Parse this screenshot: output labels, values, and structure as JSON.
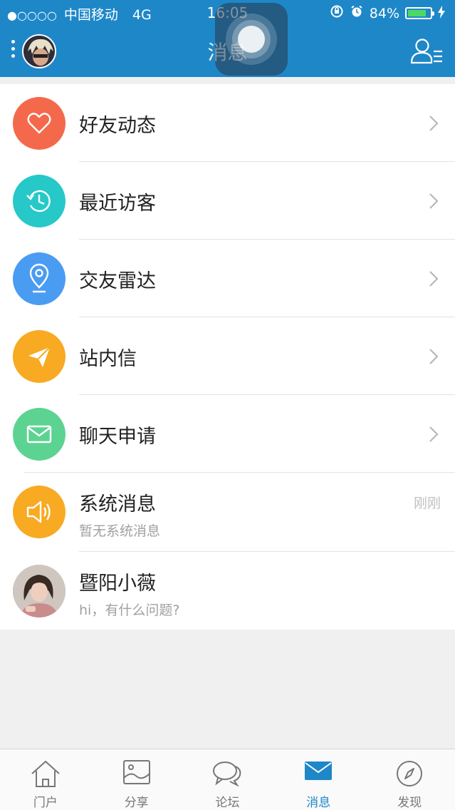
{
  "status_bar": {
    "signal": "●○○○○",
    "carrier": "中国移动",
    "network": "4G",
    "time": "16:05",
    "battery_percent": "84%",
    "battery_level": 0.84
  },
  "header": {
    "title": "消息"
  },
  "colors": {
    "header_bg": "#1e87c8",
    "friend_updates": "#f4694b",
    "recent_visitors": "#26c8c8",
    "radar": "#4a9cf2",
    "inbox": "#f8aa23",
    "chat_request": "#5dd392",
    "system": "#f8aa23"
  },
  "menu": [
    {
      "label": "好友动态",
      "icon": "heart-icon"
    },
    {
      "label": "最近访客",
      "icon": "history-clock-icon"
    },
    {
      "label": "交友雷达",
      "icon": "location-pin-icon"
    },
    {
      "label": "站内信",
      "icon": "paper-plane-icon"
    },
    {
      "label": "聊天申请",
      "icon": "envelope-icon"
    }
  ],
  "messages": [
    {
      "title": "系统消息",
      "preview": "暂无系统消息",
      "time": "刚刚",
      "icon": "speaker-icon"
    },
    {
      "title": "暨阳小薇",
      "preview": "hi，有什么问题?"
    }
  ],
  "tabs": [
    {
      "label": "门户",
      "icon": "home-icon"
    },
    {
      "label": "分享",
      "icon": "picture-icon"
    },
    {
      "label": "论坛",
      "icon": "chat-bubbles-icon"
    },
    {
      "label": "消息",
      "icon": "mail-icon",
      "active": true
    },
    {
      "label": "发现",
      "icon": "compass-icon"
    }
  ]
}
